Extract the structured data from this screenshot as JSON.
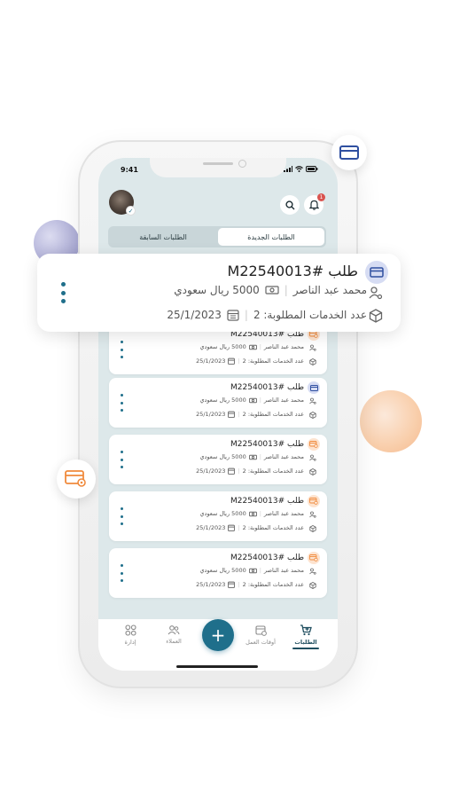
{
  "status_bar": {
    "time": "9:41"
  },
  "header": {
    "notification_count": "1"
  },
  "tabs": [
    {
      "label": "الطلبات الجديدة",
      "active": true
    },
    {
      "label": "الطلبات السابقة",
      "active": false
    }
  ],
  "highlight_order": {
    "title": "طلب #M22540013",
    "customer": "محمد عبد الناصر",
    "amount": "5000 ريال سعودي",
    "services": "عدد الخدمات المطلوبة: 2",
    "date": "25/1/2023",
    "type": "card"
  },
  "orders": [
    {
      "title": "طلب #M22540013",
      "customer": "محمد عبد الناصر",
      "amount": "5000 ريال سعودي",
      "services": "عدد الخدمات المطلوبة: 2",
      "date": "25/1/2023",
      "type": "settings"
    },
    {
      "title": "طلب #M22540013",
      "customer": "محمد عبد الناصر",
      "amount": "5000 ريال سعودي",
      "services": "عدد الخدمات المطلوبة: 2",
      "date": "25/1/2023",
      "type": "card"
    },
    {
      "title": "طلب #M22540013",
      "customer": "محمد عبد الناصر",
      "amount": "5000 ريال سعودي",
      "services": "عدد الخدمات المطلوبة: 2",
      "date": "25/1/2023",
      "type": "settings"
    },
    {
      "title": "طلب #M22540013",
      "customer": "محمد عبد الناصر",
      "amount": "5000 ريال سعودي",
      "services": "عدد الخدمات المطلوبة: 2",
      "date": "25/1/2023",
      "type": "settings"
    },
    {
      "title": "طلب #M22540013",
      "customer": "محمد عبد الناصر",
      "amount": "5000 ريال سعودي",
      "services": "عدد الخدمات المطلوبة: 2",
      "date": "25/1/2023",
      "type": "settings"
    }
  ],
  "bottom_nav": {
    "orders": "الطلبات",
    "work_times": "أوقات العمل",
    "clients": "العملاء",
    "admin": "إدارة"
  },
  "colors": {
    "primary": "#1f6f8b",
    "card_icon_bg": "#d6dcf3",
    "settings_icon_bg": "#fde3cf",
    "screen_bg": "#dde8ea"
  }
}
